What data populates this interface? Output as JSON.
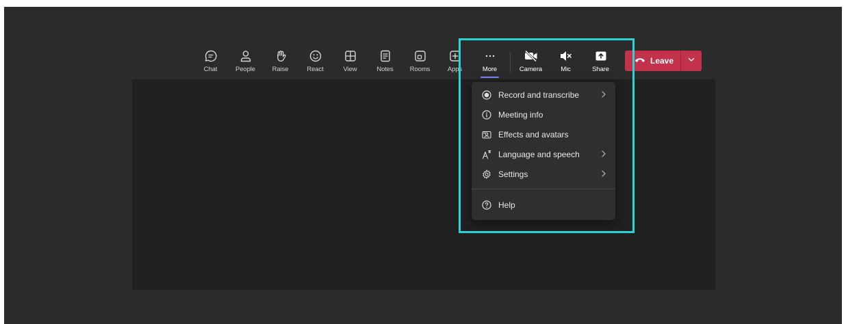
{
  "toolbar": {
    "chat": "Chat",
    "people": "People",
    "raise": "Raise",
    "react": "React",
    "view": "View",
    "notes": "Notes",
    "rooms": "Rooms",
    "apps": "Apps",
    "more": "More",
    "camera": "Camera",
    "mic": "Mic",
    "share": "Share"
  },
  "leave": {
    "label": "Leave"
  },
  "more_menu": {
    "items": [
      {
        "label": "Record and transcribe",
        "icon": "record-icon",
        "has_submenu": true
      },
      {
        "label": "Meeting info",
        "icon": "info-icon",
        "has_submenu": false
      },
      {
        "label": "Effects and avatars",
        "icon": "effects-icon",
        "has_submenu": false
      },
      {
        "label": "Language and speech",
        "icon": "language-icon",
        "has_submenu": true
      },
      {
        "label": "Settings",
        "icon": "gear-icon",
        "has_submenu": true
      }
    ],
    "help": {
      "label": "Help",
      "icon": "help-icon"
    }
  },
  "colors": {
    "leave": "#c4314b",
    "accent": "#7f85f5",
    "highlight": "#28d4d8",
    "background": "#2b2b2b",
    "stage": "#202020",
    "menu": "#2f2f2f"
  }
}
